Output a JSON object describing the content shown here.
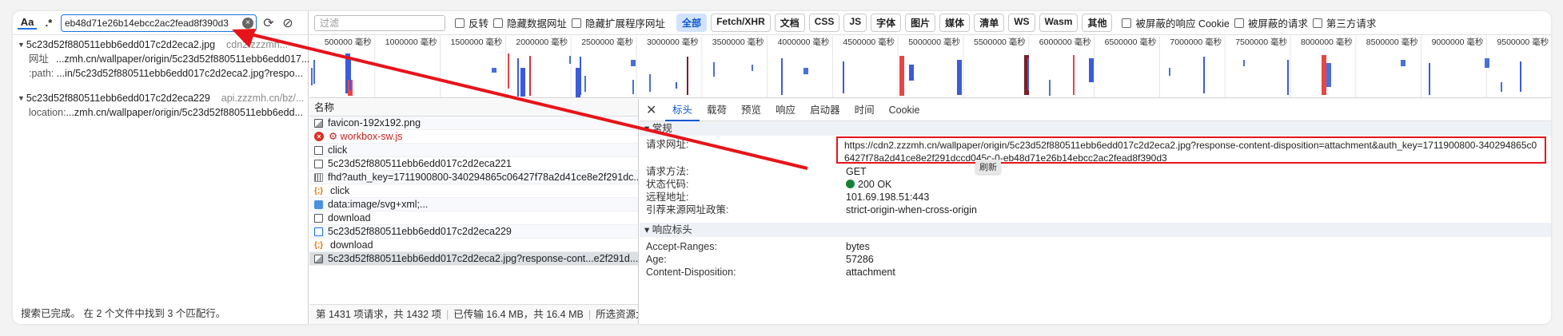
{
  "search": {
    "case_toggle": "Aa",
    "regex_toggle": ".*",
    "query": "eb48d71e26b14ebcc2ac2fead8f390d3",
    "groups": [
      {
        "file": "5c23d52f880511ebb6edd017c2d2eca2.jpg",
        "host": "cdn2.zzzmh...",
        "lines": [
          {
            "key": "网址",
            "value": "...zmh.cn/wallpaper/origin/5c23d52f880511ebb6edd017..."
          },
          {
            "key": ":path:",
            "value": "...in/5c23d52f880511ebb6edd017c2d2eca2.jpg?respo..."
          }
        ]
      },
      {
        "file": "5c23d52f880511ebb6edd017c2d2eca229",
        "host": "api.zzzmh.cn/bz/...",
        "lines": [
          {
            "key": "location:",
            "value": "...zmh.cn/wallpaper/origin/5c23d52f880511ebb6edd..."
          }
        ]
      }
    ],
    "status": "搜索已完成。 在 2 个文件中找到 3 个匹配行。"
  },
  "filter": {
    "placeholder": "过滤",
    "checks": [
      "反转",
      "隐藏数据网址",
      "隐藏扩展程序网址"
    ],
    "types": [
      "全部",
      "Fetch/XHR",
      "文档",
      "CSS",
      "JS",
      "字体",
      "图片",
      "媒体",
      "清单",
      "WS",
      "Wasm",
      "其他"
    ],
    "active_type": "全部",
    "extra_checks": [
      "被屏蔽的响应 Cookie",
      "被屏蔽的请求",
      "第三方请求"
    ]
  },
  "overview": {
    "ticks": [
      "500000 毫秒",
      "1000000 毫秒",
      "1500000 毫秒",
      "2000000 毫秒",
      "2500000 毫秒",
      "3000000 毫秒",
      "3500000 毫秒",
      "4000000 毫秒",
      "4500000 毫秒",
      "5000000 毫秒",
      "5500000 毫秒",
      "6000000 毫秒",
      "6500000 毫秒",
      "7000000 毫秒",
      "7500000 毫秒",
      "8000000 毫秒",
      "8500000 毫秒",
      "9000000 毫秒",
      "9500000 毫秒"
    ]
  },
  "requests": {
    "column": "名称",
    "rows": [
      {
        "icon": "img",
        "name": "favicon-192x192.png",
        "state": ""
      },
      {
        "icon": "err",
        "name": "⚙ workbox-sw.js",
        "state": "error"
      },
      {
        "icon": "doc",
        "name": "click",
        "state": ""
      },
      {
        "icon": "doc",
        "name": "5c23d52f880511ebb6edd017c2d2eca221",
        "state": ""
      },
      {
        "icon": "ws",
        "name": "fhd?auth_key=1711900800-340294865c06427f78a2d41ce8e2f291dc...",
        "state": ""
      },
      {
        "icon": "script",
        "name": "click",
        "state": ""
      },
      {
        "icon": "svg",
        "name": "data:image/svg+xml;...",
        "state": ""
      },
      {
        "icon": "doc",
        "name": "download",
        "state": ""
      },
      {
        "icon": "fetch",
        "name": "5c23d52f880511ebb6edd017c2d2eca229",
        "state": ""
      },
      {
        "icon": "script",
        "name": "download",
        "state": ""
      },
      {
        "icon": "img",
        "name": "5c23d52f880511ebb6edd017c2d2eca2.jpg?response-cont...e2f291d...",
        "state": "selected"
      }
    ],
    "footer": [
      "第 1431 项请求，共 1432 项",
      "已传输 16.4 MB，共 16.4 MB",
      "所选资源大"
    ]
  },
  "detail": {
    "tabs": [
      "标头",
      "载荷",
      "预览",
      "响应",
      "启动器",
      "时间",
      "Cookie"
    ],
    "active_tab": "标头",
    "general_title": "常规",
    "general": [
      {
        "k": "请求网址:",
        "v": "https://cdn2.zzzmh.cn/wallpaper/origin/5c23d52f880511ebb6edd017c2d2eca2.jpg?response-content-disposition=attachment&auth_key=1711900800-340294865c06427f78a2d41ce8e2f291dccd045c-0-eb48d71e26b14ebcc2ac2fead8f390d3"
      },
      {
        "k": "请求方法:",
        "v": "GET"
      },
      {
        "k": "状态代码:",
        "v": "200 OK"
      },
      {
        "k": "远程地址:",
        "v": "101.69.198.51:443"
      },
      {
        "k": "引荐来源网址政策:",
        "v": "strict-origin-when-cross-origin"
      }
    ],
    "tooltip": "刷新",
    "response_title": "响应标头",
    "response": [
      {
        "k": "Accept-Ranges:",
        "v": "bytes"
      },
      {
        "k": "Age:",
        "v": "57286"
      },
      {
        "k": "Content-Disposition:",
        "v": "attachment"
      }
    ]
  },
  "colors": {
    "accent": "#0b57d0",
    "annotation": "#e8131a",
    "status_ok": "#188038"
  }
}
